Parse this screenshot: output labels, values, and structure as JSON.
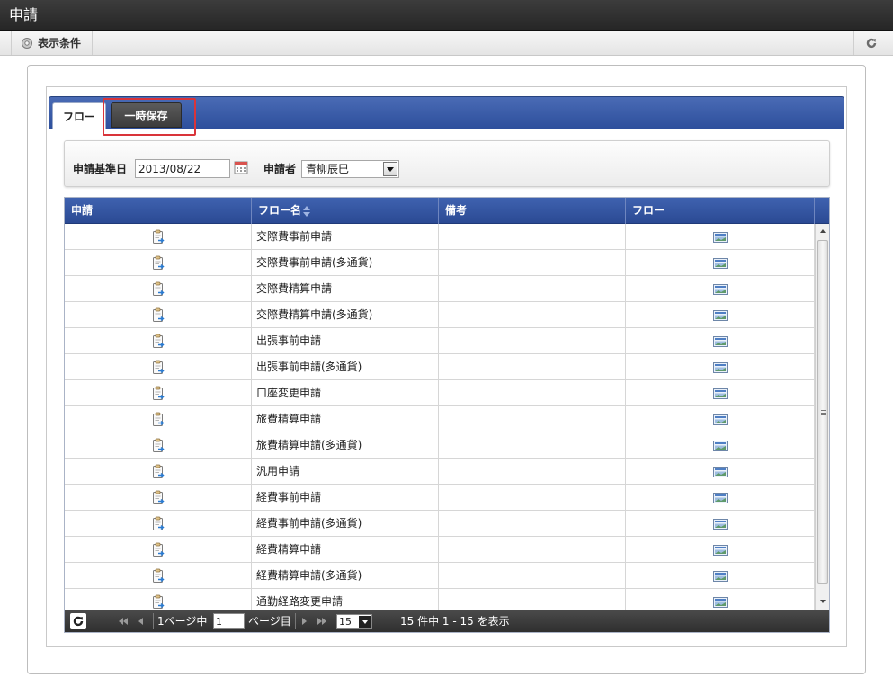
{
  "window": {
    "title": "申請"
  },
  "toolbar": {
    "conditions_label": "表示条件"
  },
  "tabs": [
    {
      "label": "フロー",
      "active": true
    },
    {
      "label": "一時保存",
      "active": false
    }
  ],
  "filter": {
    "base_date_label": "申請基準日",
    "base_date_value": "2013/08/22",
    "applicant_label": "申請者",
    "applicant_value": "青柳辰巳"
  },
  "grid": {
    "columns": [
      "申請",
      "フロー名",
      "備考",
      "フロー"
    ],
    "rows": [
      {
        "flow_name": "交際費事前申請",
        "note": ""
      },
      {
        "flow_name": "交際費事前申請(多通貨)",
        "note": ""
      },
      {
        "flow_name": "交際費精算申請",
        "note": ""
      },
      {
        "flow_name": "交際費精算申請(多通貨)",
        "note": ""
      },
      {
        "flow_name": "出張事前申請",
        "note": ""
      },
      {
        "flow_name": "出張事前申請(多通貨)",
        "note": ""
      },
      {
        "flow_name": "口座変更申請",
        "note": ""
      },
      {
        "flow_name": "旅費精算申請",
        "note": ""
      },
      {
        "flow_name": "旅費精算申請(多通貨)",
        "note": ""
      },
      {
        "flow_name": "汎用申請",
        "note": ""
      },
      {
        "flow_name": "経費事前申請",
        "note": ""
      },
      {
        "flow_name": "経費事前申請(多通貨)",
        "note": ""
      },
      {
        "flow_name": "経費精算申請",
        "note": ""
      },
      {
        "flow_name": "経費精算申請(多通貨)",
        "note": ""
      },
      {
        "flow_name": "通勤経路変更申請",
        "note": ""
      }
    ]
  },
  "pager": {
    "page_prefix": "1ページ中",
    "page_value": "1",
    "page_suffix": "ページ目",
    "page_size": "15",
    "summary": "15 件中 1 - 15 を表示"
  },
  "colors": {
    "accent": "#2d4f9c",
    "highlight": "#d9343a",
    "titlebar": "#2c2c2c"
  },
  "icons": {
    "apply": "clipboard-icon",
    "flow": "flow-diagram-icon",
    "calendar": "calendar-icon",
    "gear": "gear-icon",
    "refresh": "refresh-icon"
  }
}
